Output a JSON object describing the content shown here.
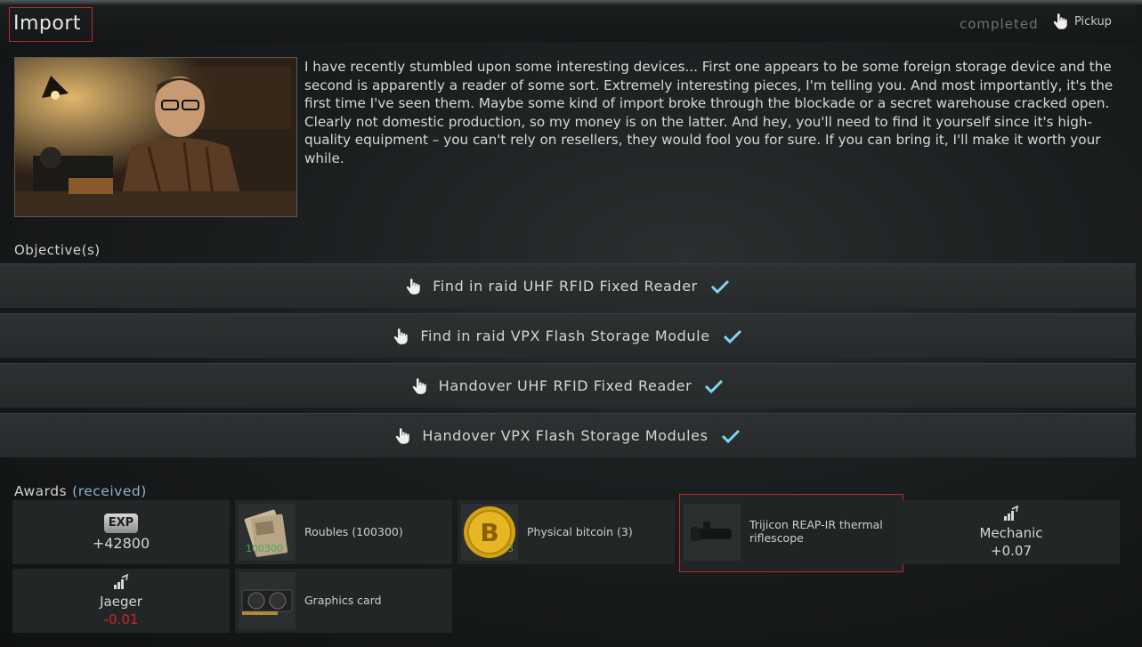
{
  "quest": {
    "title": "Import",
    "status": "completed",
    "pickup_label": "Pickup",
    "description": "I have recently stumbled upon some interesting devices... First one appears to be some foreign storage device and the second is apparently a reader of some sort. Extremely interesting pieces, I'm telling you. And most importantly, it's the first time I've seen them. Maybe some kind of import broke through the blockade or a secret warehouse cracked open. Clearly not domestic production, so my money is on the latter. And hey, you'll need to find it yourself since it's high-quality equipment – you can't rely on resellers, they would fool you for sure. If you can bring it, I'll make it worth your while."
  },
  "objectives_label": "Objective(s)",
  "objectives": [
    {
      "text": "Find in raid UHF RFID Fixed Reader",
      "done": true
    },
    {
      "text": "Find in raid VPX Flash Storage Module",
      "done": true
    },
    {
      "text": "Handover UHF RFID Fixed Reader",
      "done": true
    },
    {
      "text": "Handover VPX Flash Storage Modules",
      "done": true
    }
  ],
  "awards_label": "Awards",
  "awards_status": "(received)",
  "awards": {
    "exp": {
      "badge": "EXP",
      "value": "+42800"
    },
    "roubles": {
      "label": "Roubles (100300)",
      "qty": "100300"
    },
    "bitcoin": {
      "label": "Physical bitcoin (3)",
      "qty": "3"
    },
    "scope": {
      "label": "Trijicon REAP-IR thermal riflescope"
    },
    "mechanic": {
      "name": "Mechanic",
      "value": "+0.07"
    },
    "jaeger": {
      "name": "Jaeger",
      "value": "-0.01"
    },
    "gpu": {
      "label": "Graphics card"
    }
  },
  "colors": {
    "highlight": "#c0282a",
    "check": "#7fd4f2",
    "negative": "#d02323",
    "received": "#8fb3c9"
  }
}
